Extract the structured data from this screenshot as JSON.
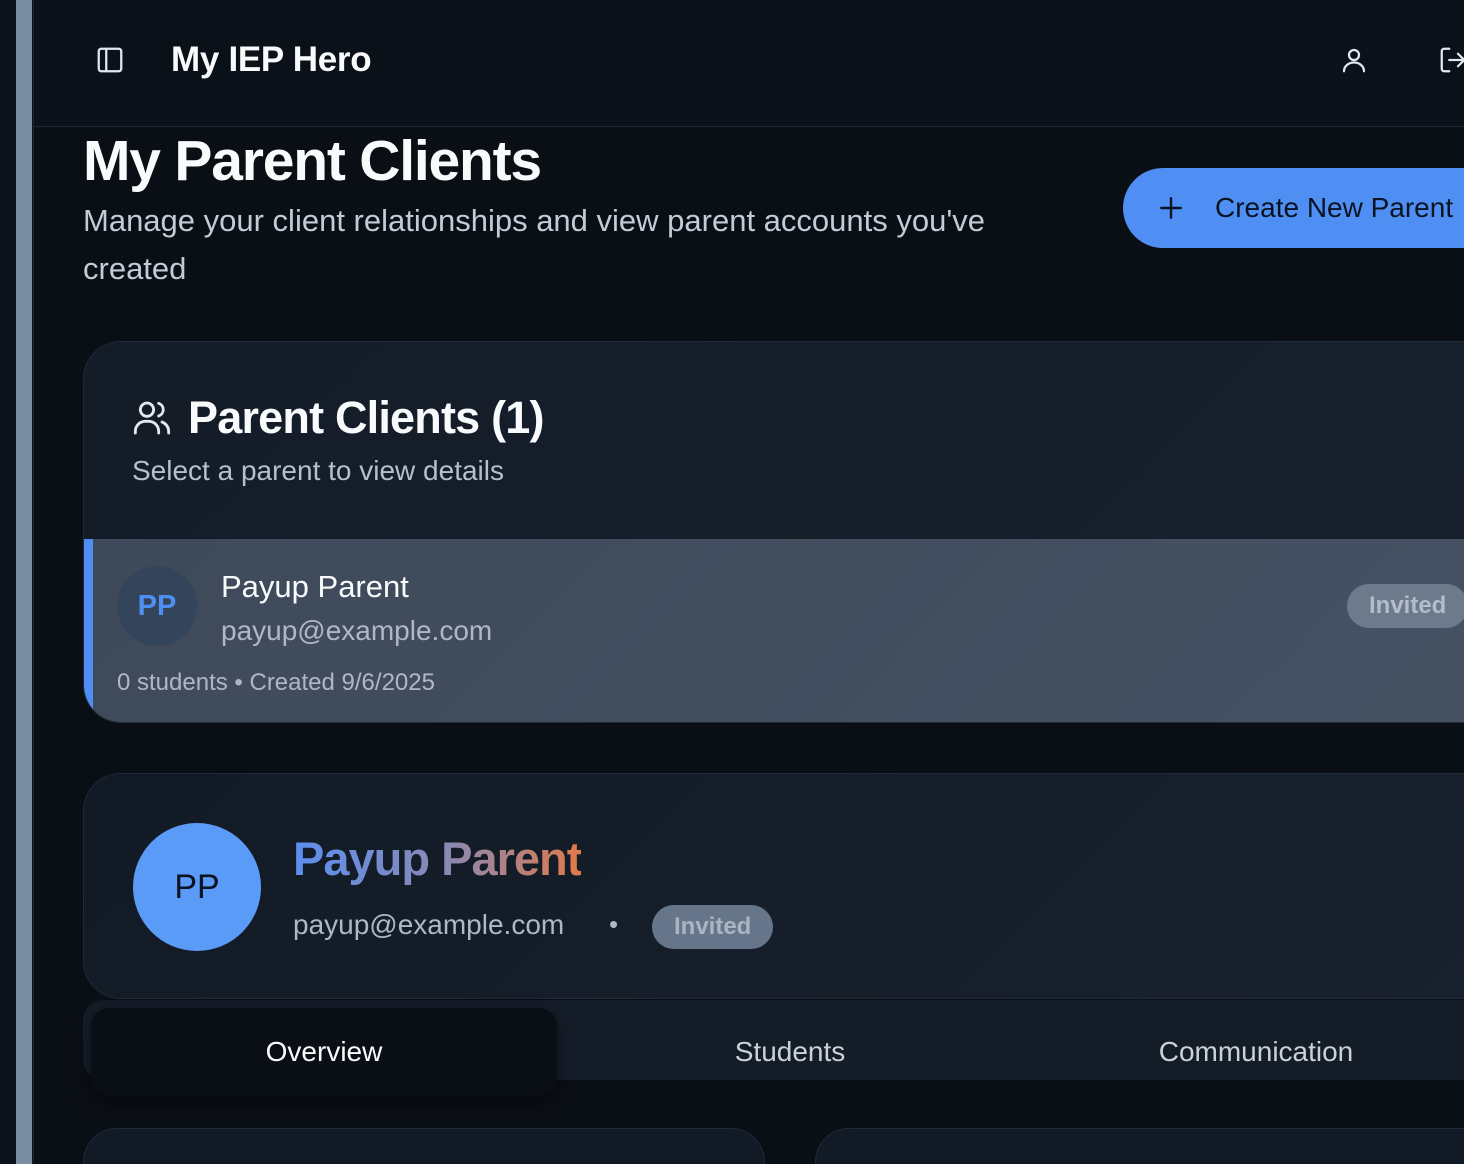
{
  "header": {
    "app_title": "My IEP Hero",
    "sidebar_toggle_icon": "panel-left-icon",
    "user_icon": "user-icon",
    "logout_icon": "log-out-icon"
  },
  "page": {
    "title": "My Parent Clients",
    "subtitle": "Manage your client relationships and view parent accounts you've created",
    "create_button_label": "Create New Parent"
  },
  "clients_card": {
    "title": "Parent Clients (1)",
    "subtitle": "Select a parent to view details",
    "clients": [
      {
        "initials": "PP",
        "name": "Payup Parent",
        "email": "payup@example.com",
        "meta": "0 students • Created 9/6/2025",
        "status": "Invited"
      }
    ]
  },
  "detail": {
    "initials": "PP",
    "name": "Payup Parent",
    "email": "payup@example.com",
    "separator": "•",
    "status": "Invited"
  },
  "tabs": [
    {
      "label": "Overview",
      "active": true
    },
    {
      "label": "Students",
      "active": false
    },
    {
      "label": "Communication",
      "active": false
    }
  ],
  "colors": {
    "accent": "#4f8ff4",
    "background": "#0a0e15",
    "card": "#141c28",
    "selected_row": "#424e5f",
    "badge": "#6c7a8c"
  }
}
